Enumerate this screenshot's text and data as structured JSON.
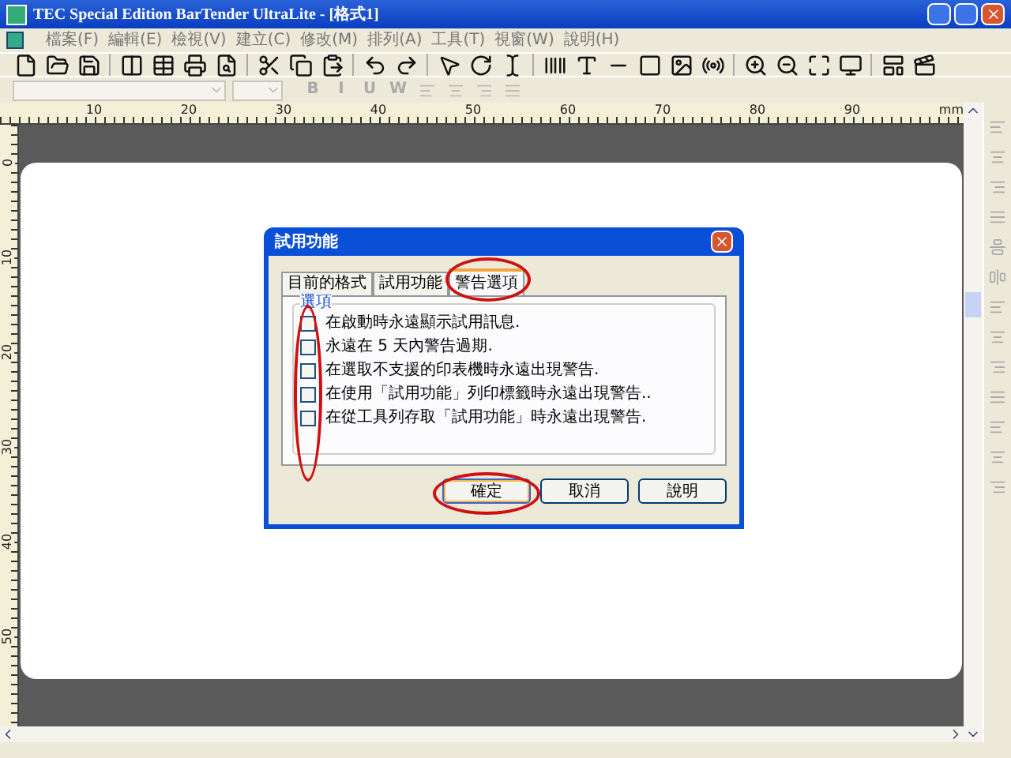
{
  "window": {
    "title": "TEC Special Edition BarTender UltraLite - [格式1]"
  },
  "menu": [
    "檔案(F)",
    "編輯(E)",
    "檢視(V)",
    "建立(C)",
    "修改(M)",
    "排列(A)",
    "工具(T)",
    "視窗(W)",
    "說明(H)"
  ],
  "format_toolbar": {
    "buttons": [
      "B",
      "I",
      "U",
      "W"
    ]
  },
  "ruler": {
    "top_labels": [
      "10",
      "20",
      "30",
      "40",
      "50",
      "60",
      "70",
      "80",
      "90"
    ],
    "unit": "mm",
    "left_labels": [
      "0",
      "10",
      "20",
      "30",
      "40",
      "50"
    ]
  },
  "dialog": {
    "title": "試用功能",
    "tabs": [
      {
        "label": "目前的格式",
        "selected": false
      },
      {
        "label": "試用功能",
        "selected": false
      },
      {
        "label": "警告選項",
        "selected": true
      }
    ],
    "group": "選項",
    "options": [
      {
        "label": "在啟動時永遠顯示試用訊息.",
        "checked": false
      },
      {
        "label": "永遠在 5 天內警告過期.",
        "checked": false
      },
      {
        "label": "在選取不支援的印表機時永遠出現警告.",
        "checked": false
      },
      {
        "label": "在使用「試用功能」列印標籤時永遠出現警告..",
        "checked": false
      },
      {
        "label": "在從工具列存取「試用功能」時永遠出現警告.",
        "checked": false
      }
    ],
    "buttons": [
      {
        "label": "確定",
        "default": true
      },
      {
        "label": "取消",
        "default": false
      },
      {
        "label": "說明",
        "default": false
      }
    ]
  }
}
